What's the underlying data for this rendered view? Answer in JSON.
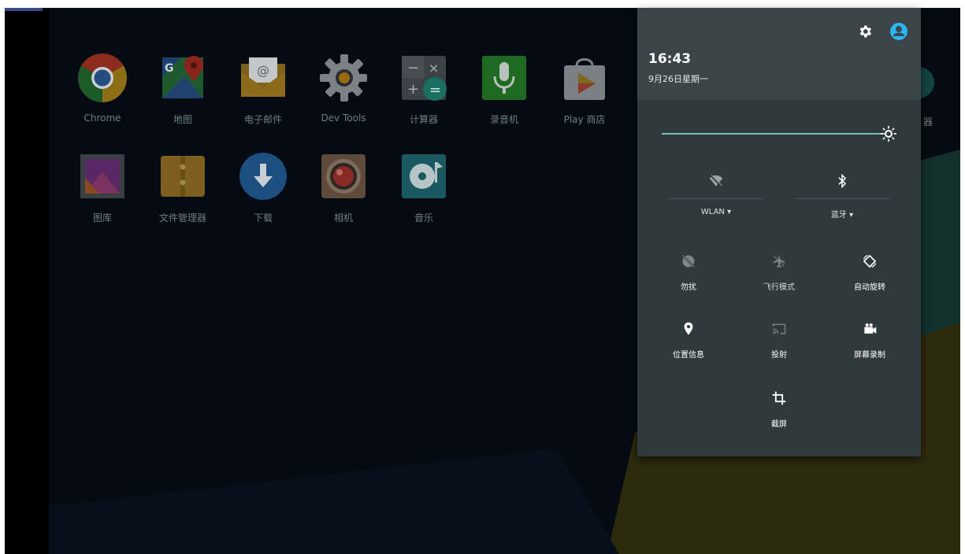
{
  "apps_row1": [
    {
      "label": "Chrome",
      "icon": "chrome-icon"
    },
    {
      "label": "地图",
      "icon": "maps-icon"
    },
    {
      "label": "电子邮件",
      "icon": "email-icon"
    },
    {
      "label": "Dev Tools",
      "icon": "dev-tools-gear-icon"
    },
    {
      "label": "计算器",
      "icon": "calculator-icon"
    },
    {
      "label": "录音机",
      "icon": "microphone-icon"
    },
    {
      "label": "Play 商店",
      "icon": "play-store-icon"
    }
  ],
  "apps_row2": [
    {
      "label": "图库",
      "icon": "gallery-icon"
    },
    {
      "label": "文件管理器",
      "icon": "file-manager-icon"
    },
    {
      "label": "下载",
      "icon": "download-icon"
    },
    {
      "label": "相机",
      "icon": "camera-icon"
    },
    {
      "label": "音乐",
      "icon": "music-icon"
    }
  ],
  "partial_app_label": "器",
  "quick_settings": {
    "time": "16:43",
    "date": "9月26日星期一",
    "header_icons": [
      "settings-gear-icon",
      "user-account-icon"
    ],
    "brightness_fraction": 0.96,
    "wlan_label": "WLAN ▾",
    "bluetooth_label": "蓝牙 ▾",
    "tiles": [
      {
        "label": "勿扰",
        "icon": "do-not-disturb-icon"
      },
      {
        "label": "飞行模式",
        "icon": "airplane-icon"
      },
      {
        "label": "自动旋转",
        "icon": "auto-rotate-icon"
      },
      {
        "label": "位置信息",
        "icon": "location-pin-icon"
      },
      {
        "label": "投射",
        "icon": "cast-icon"
      },
      {
        "label": "屏幕录制",
        "icon": "screen-record-icon"
      },
      {
        "label": "截屏",
        "icon": "screenshot-crop-icon"
      }
    ]
  },
  "colors": {
    "panel": "#30393e",
    "panel_header": "#3b4549",
    "accent_teal": "#6fc1ba",
    "user_icon_blue": "#29b6f6"
  }
}
